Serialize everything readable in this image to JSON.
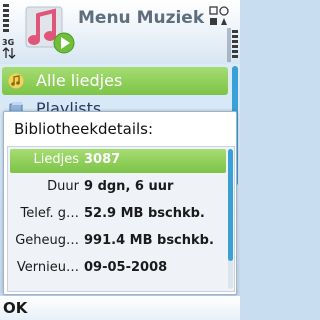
{
  "header": {
    "title": "Menu Muziek",
    "network_label": "3G"
  },
  "list": {
    "items": [
      {
        "label": "Alle liedjes",
        "selected": true,
        "icon": "music-note-icon"
      },
      {
        "label": "Playlists",
        "selected": false,
        "icon": "playlist-icon"
      }
    ]
  },
  "dialog": {
    "heading": "Bibliotheekdetails:",
    "rows": [
      {
        "label": "Liedjes",
        "value": "3087"
      },
      {
        "label": "Duur",
        "value": "9 dgn, 6 uur"
      },
      {
        "label": "Telef. g…",
        "value": "52.9 MB bschkb."
      },
      {
        "label": "Geheug…",
        "value": "991.4 MB bschkb."
      },
      {
        "label": "Vernieu…",
        "value": "09-05-2008"
      }
    ]
  },
  "softkeys": {
    "left": "OK"
  },
  "colors": {
    "highlight": "#7cc448",
    "scroll_accent": "#3aa0d8",
    "title_text": "#5f6e7e"
  }
}
